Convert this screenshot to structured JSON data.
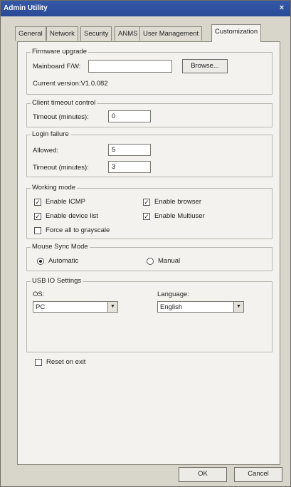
{
  "window": {
    "title": "Admin Utility",
    "close_glyph": "×"
  },
  "tabs": [
    {
      "label": "General"
    },
    {
      "label": "Network"
    },
    {
      "label": "Security"
    },
    {
      "label": "ANMS"
    },
    {
      "label": "User Management"
    },
    {
      "label": "Customization",
      "active": true
    }
  ],
  "firmware": {
    "legend": "Firmware upgrade",
    "mainboard_label": "Mainboard F/W:",
    "mainboard_value": "",
    "browse_label": "Browse...",
    "current_version": "Current version:V1.0.082"
  },
  "client_timeout": {
    "legend": "Client timeout control",
    "timeout_label": "Timeout (minutes):",
    "timeout_value": "0"
  },
  "login_failure": {
    "legend": "Login failure",
    "allowed_label": "Allowed:",
    "allowed_value": "5",
    "timeout_label": "Timeout (minutes):",
    "timeout_value": "3"
  },
  "working_mode": {
    "legend": "Working mode",
    "enable_icmp": {
      "label": "Enable ICMP",
      "checked": true
    },
    "enable_browser": {
      "label": "Enable browser",
      "checked": true
    },
    "enable_device_list": {
      "label": "Enable device list",
      "checked": true
    },
    "enable_multiuser": {
      "label": "Enable Multiuser",
      "checked": true
    },
    "force_grayscale": {
      "label": "Force all to grayscale",
      "checked": false
    },
    "check_glyph": "✓"
  },
  "mouse_sync": {
    "legend": "Mouse Sync Mode",
    "automatic_label": "Automatic",
    "manual_label": "Manual",
    "selected": "automatic"
  },
  "usb_io": {
    "legend": "USB IO Settings",
    "os_label": "OS:",
    "os_value": "PC",
    "language_label": "Language:",
    "language_value": "English",
    "arrow_glyph": "▼"
  },
  "reset_on_exit": {
    "label": "Reset on exit",
    "checked": false
  },
  "buttons": {
    "ok": "OK",
    "cancel": "Cancel"
  }
}
